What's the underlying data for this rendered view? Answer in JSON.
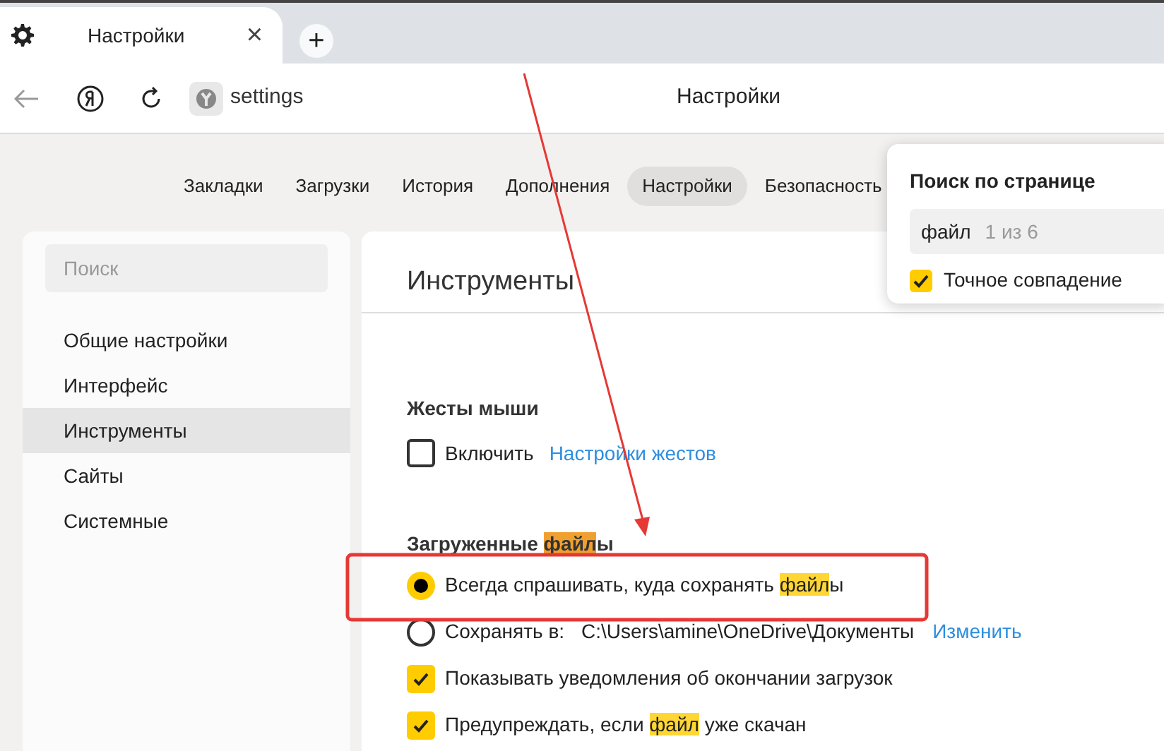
{
  "browser_tab": {
    "title": "Настройки",
    "close": "×",
    "new_tab": "+"
  },
  "address_bar": {
    "url": "settings",
    "page_title": "Настройки"
  },
  "nav_tabs": [
    {
      "label": "Закладки",
      "selected": false
    },
    {
      "label": "Загрузки",
      "selected": false
    },
    {
      "label": "История",
      "selected": false
    },
    {
      "label": "Дополнения",
      "selected": false
    },
    {
      "label": "Настройки",
      "selected": true
    },
    {
      "label": "Безопасность",
      "selected": false
    }
  ],
  "sidebar": {
    "search": {
      "placeholder": "Поиск"
    },
    "items": [
      {
        "label": "Общие настройки",
        "selected": false
      },
      {
        "label": "Интерфейс",
        "selected": false
      },
      {
        "label": "Инструменты",
        "selected": true
      },
      {
        "label": "Сайты",
        "selected": false
      },
      {
        "label": "Системные",
        "selected": false
      }
    ]
  },
  "content": {
    "title": "Инструменты",
    "mouse_gestures": {
      "heading": "Жесты мыши",
      "checkbox": {
        "label": "Включить",
        "checked": false
      },
      "link": "Настройки жестов"
    },
    "downloads": {
      "heading": [
        {
          "text": "Загруженные ",
          "highlighted": false
        },
        {
          "text": "файл",
          "highlighted": true,
          "current": true
        },
        {
          "text": "ы",
          "highlighted": false
        }
      ],
      "options": [
        {
          "kind": "radio",
          "selected": true,
          "parts": [
            {
              "text": "Всегда спрашивать, куда сохранять ",
              "highlighted": false
            },
            {
              "text": "файл",
              "highlighted": true,
              "current": false
            },
            {
              "text": "ы",
              "highlighted": false
            }
          ]
        },
        {
          "kind": "radio",
          "selected": false,
          "parts": [
            {
              "text": "Сохранять в:",
              "highlighted": false
            }
          ],
          "path": "C:\\Users\\amine\\OneDrive\\Документы",
          "link": "Изменить"
        },
        {
          "kind": "checkbox",
          "checked": true,
          "parts": [
            {
              "text": "Показывать уведомления об окончании загрузок",
              "highlighted": false
            }
          ]
        },
        {
          "kind": "checkbox",
          "checked": true,
          "parts": [
            {
              "text": "Предупреждать, если ",
              "highlighted": false
            },
            {
              "text": "файл",
              "highlighted": true,
              "current": false
            },
            {
              "text": " уже скачан",
              "highlighted": false
            }
          ]
        }
      ]
    }
  },
  "find_popup": {
    "title": "Поиск по странице",
    "query": "файл",
    "count": "1 из 6",
    "exact_match": {
      "label": "Точное совпадение",
      "checked": true
    }
  }
}
